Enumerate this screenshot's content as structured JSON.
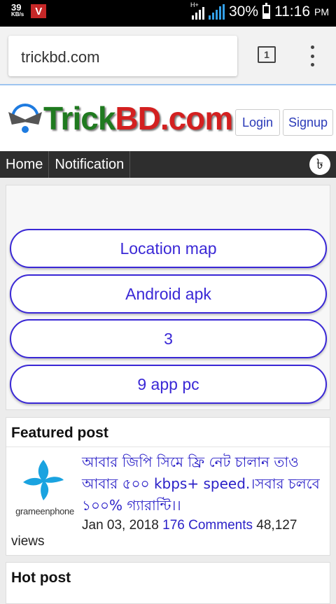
{
  "status_bar": {
    "net_speed": "39",
    "net_speed_unit": "KB/s",
    "app_badge": "V",
    "network_type": "H+",
    "battery": "30%",
    "time": "11:16",
    "ampm": "PM"
  },
  "browser": {
    "url": "trickbd.com",
    "tab_count": "1"
  },
  "site": {
    "logo_text": "TrickBD.com",
    "logo_trick": "Trick",
    "logo_bd": "BD",
    "logo_com": ".com",
    "login_label": "Login",
    "signup_label": "Signup",
    "currency_symbol": "৳"
  },
  "nav": {
    "items": [
      {
        "label": "Home"
      },
      {
        "label": "Notification"
      }
    ]
  },
  "links": [
    {
      "label": "Location map"
    },
    {
      "label": "Android apk"
    },
    {
      "label": "3"
    },
    {
      "label": "9 app pc"
    }
  ],
  "featured": {
    "heading": "Featured post",
    "thumb_label": "grameenphone",
    "title": "আবার জিপি সিমে ফ্রি নেট চালান তাও আবার ৫০০ kbps+ speed.।সবার চলবে ১০০% গ্যারান্টি।।",
    "date": "Jan 03, 2018",
    "comments": "176 Comments",
    "views_count": "48,127",
    "views_label": "views"
  },
  "hot": {
    "heading": "Hot post"
  },
  "colors": {
    "accent": "#3a28d6",
    "nav_bg": "#2e2e2e",
    "logo_green": "#1f7a1f",
    "logo_red": "#d32020"
  }
}
